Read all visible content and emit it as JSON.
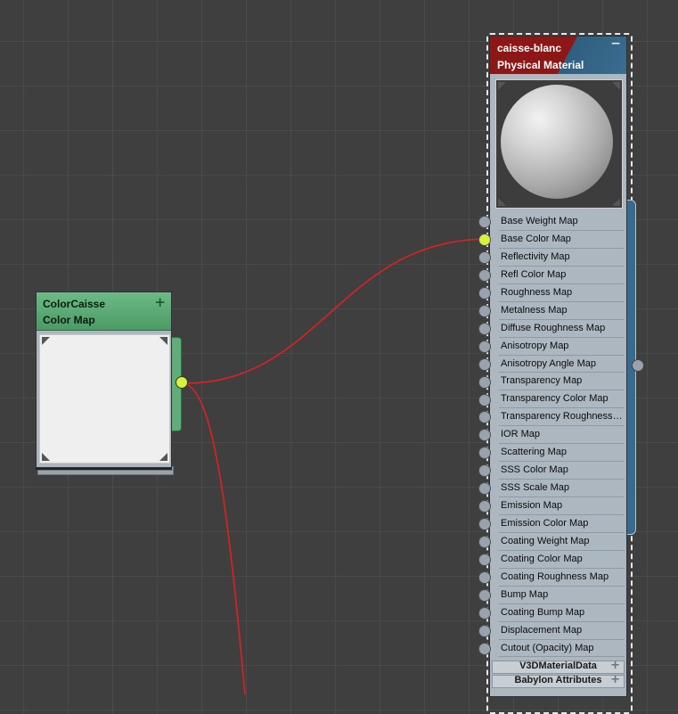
{
  "color_map_node": {
    "name": "ColorCaisse",
    "type": "Color Map",
    "add_icon": "plus-icon"
  },
  "material_node": {
    "name": "caisse-blanc",
    "type": "Physical Material",
    "collapse_icon": "minimize-icon",
    "slots": [
      {
        "label": "Base Weight Map"
      },
      {
        "label": "Base Color Map",
        "connected": true
      },
      {
        "label": "Reflectivity Map"
      },
      {
        "label": "Refl Color Map"
      },
      {
        "label": "Roughness Map"
      },
      {
        "label": "Metalness Map"
      },
      {
        "label": "Diffuse Roughness Map"
      },
      {
        "label": "Anisotropy Map"
      },
      {
        "label": "Anisotropy Angle Map"
      },
      {
        "label": "Transparency Map"
      },
      {
        "label": "Transparency Color Map"
      },
      {
        "label": "Transparency Roughness Map"
      },
      {
        "label": "IOR Map"
      },
      {
        "label": "Scattering Map"
      },
      {
        "label": "SSS Color Map"
      },
      {
        "label": "SSS Scale Map"
      },
      {
        "label": "Emission Map"
      },
      {
        "label": "Emission Color Map"
      },
      {
        "label": "Coating Weight Map"
      },
      {
        "label": "Coating Color Map"
      },
      {
        "label": "Coating Roughness Map"
      },
      {
        "label": "Bump Map"
      },
      {
        "label": "Coating Bump Map"
      },
      {
        "label": "Displacement Map"
      },
      {
        "label": "Cutout (Opacity) Map"
      }
    ],
    "rollouts": [
      {
        "label": "V3DMaterialData",
        "icon": "plus-icon"
      },
      {
        "label": "Babylon Attributes",
        "icon": "plus-icon"
      }
    ]
  },
  "colors": {
    "canvas": "#3f3f3f",
    "wire": "#e02020",
    "active_socket": "#d7f23a",
    "map_header": "#5aa874",
    "material_header_left": "#8d1616",
    "material_header_right": "#34668a"
  }
}
